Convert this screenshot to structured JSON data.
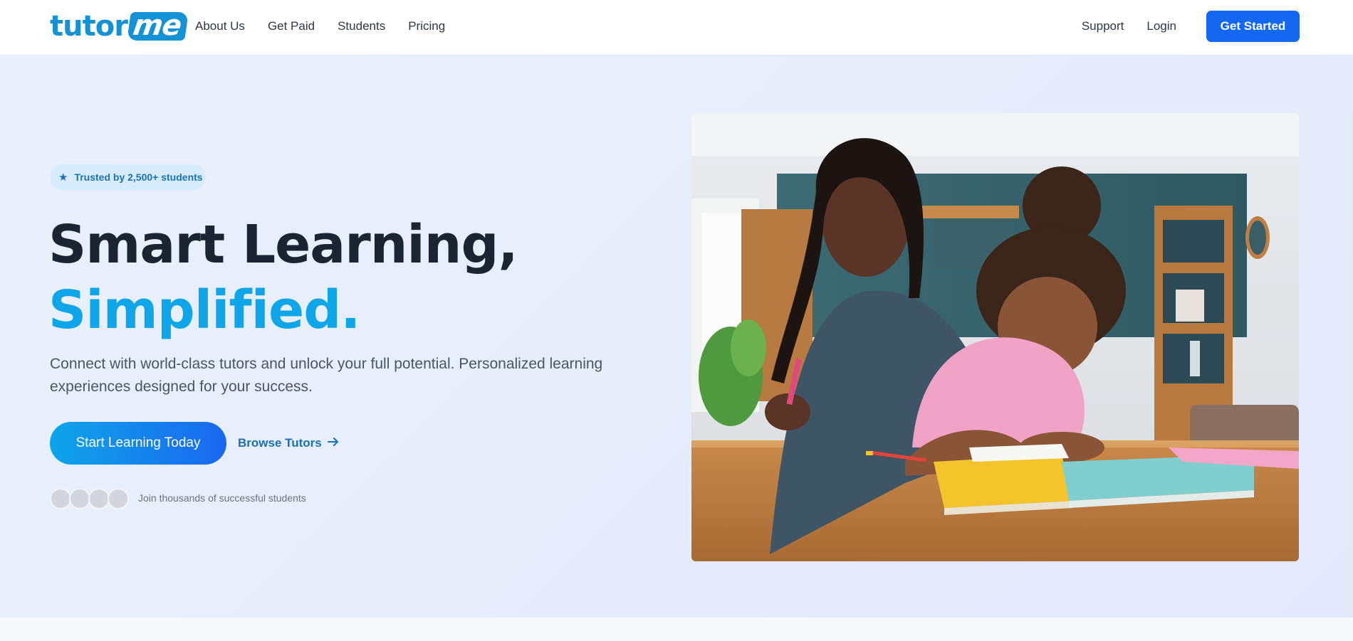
{
  "brand": {
    "logo_part1": "tutor",
    "logo_part2": "me"
  },
  "nav": {
    "items": [
      "About Us",
      "Get Paid",
      "Students",
      "Pricing"
    ],
    "right": {
      "support": "Support",
      "login": "Login",
      "get_started": "Get Started"
    }
  },
  "hero": {
    "badge": "Trusted by 2,500+ students",
    "headline_line1": "Smart Learning,",
    "headline_line2": "Simplified.",
    "subtext": "Connect with world-class tutors and unlock your full potential. Personalized learning experiences designed for your success.",
    "cta_primary": "Start Learning Today",
    "cta_secondary": "Browse Tutors",
    "social_proof": "Join thousands of successful students"
  },
  "colors": {
    "brand_blue": "#1467f0",
    "accent_sky": "#0ea5e9"
  },
  "icons": {
    "badge_icon": "star-icon",
    "secondary_cta_icon": "arrow-right-icon"
  }
}
